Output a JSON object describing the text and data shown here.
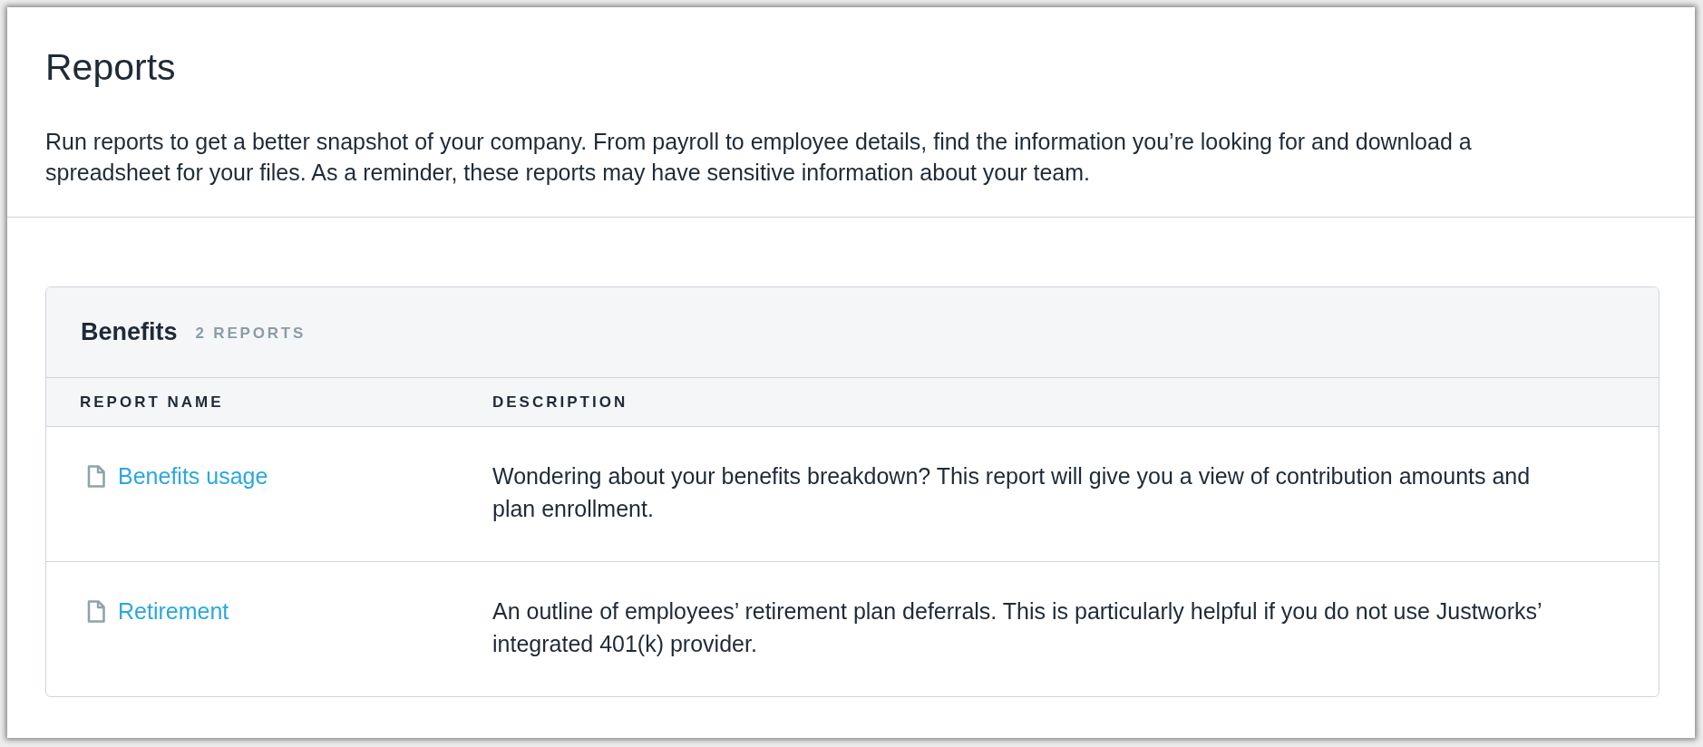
{
  "page": {
    "title": "Reports",
    "description": "Run reports to get a better snapshot of your company. From payroll to employee details, find the information you’re looking for and download a spreadsheet for your files. As a reminder, these reports may have sensitive information about your team."
  },
  "report_group": {
    "title": "Benefits",
    "count": "2 REPORTS",
    "columns": [
      "REPORT NAME",
      "DESCRIPTION"
    ],
    "rows": [
      {
        "name": "Benefits usage",
        "description": "Wondering about your benefits breakdown? This report will give you a view of contribution amounts and plan enrollment."
      },
      {
        "name": "Retirement",
        "description": "An outline of employees’ retirement plan deferrals. This is particularly helpful if you do not use Justworks’ integrated 401(k) provider."
      }
    ]
  }
}
